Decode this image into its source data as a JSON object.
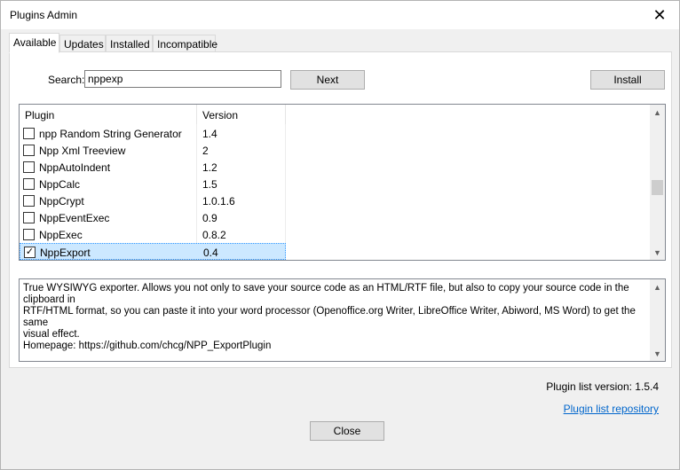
{
  "window": {
    "title": "Plugins Admin",
    "close_glyph": "✕"
  },
  "tabs": [
    {
      "label": "Available",
      "active": true
    },
    {
      "label": "Updates",
      "active": false
    },
    {
      "label": "Installed",
      "active": false
    },
    {
      "label": "Incompatible",
      "active": false
    }
  ],
  "search": {
    "label": "Search:",
    "value": "nppexp"
  },
  "buttons": {
    "next": "Next",
    "install": "Install",
    "close": "Close"
  },
  "table": {
    "columns": [
      "Plugin",
      "Version"
    ],
    "rows": [
      {
        "name": "npp Random String Generator",
        "version": "1.4",
        "checked": false,
        "selected": false
      },
      {
        "name": "Npp Xml Treeview",
        "version": "2",
        "checked": false,
        "selected": false
      },
      {
        "name": "NppAutoIndent",
        "version": "1.2",
        "checked": false,
        "selected": false
      },
      {
        "name": "NppCalc",
        "version": "1.5",
        "checked": false,
        "selected": false
      },
      {
        "name": "NppCrypt",
        "version": "1.0.1.6",
        "checked": false,
        "selected": false
      },
      {
        "name": "NppEventExec",
        "version": "0.9",
        "checked": false,
        "selected": false
      },
      {
        "name": "NppExec",
        "version": "0.8.2",
        "checked": false,
        "selected": false
      },
      {
        "name": "NppExport",
        "version": "0.4",
        "checked": true,
        "selected": true
      }
    ],
    "scroll_position": 0.55
  },
  "description": {
    "text": "True WYSIWYG exporter. Allows you not only to save your source code as an HTML/RTF file, but also to copy your source code in the clipboard in\nRTF/HTML format, so you can paste it into your word processor (Openoffice.org Writer, LibreOffice Writer, Abiword, MS Word) to get the same\nvisual effect.\nHomepage: https://github.com/chcg/NPP_ExportPlugin"
  },
  "footer": {
    "plugin_list_version": "Plugin list version:  1.5.4",
    "repo_link": "Plugin list repository"
  },
  "icons": {
    "check": "✓",
    "scroll_up": "▲",
    "scroll_down": "▼"
  }
}
